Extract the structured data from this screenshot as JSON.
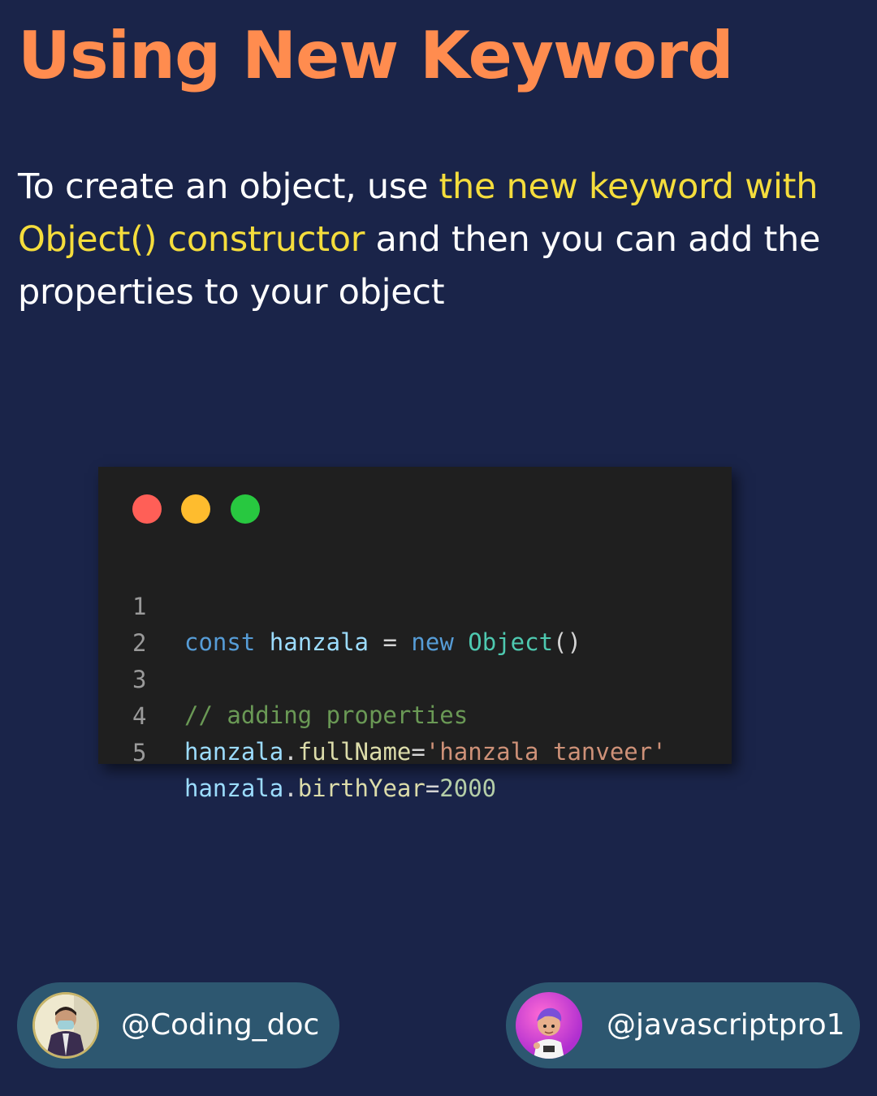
{
  "title": "Using New Keyword",
  "description": {
    "part1": "To create an object, use ",
    "highlight": "the new keyword with Object() constructor",
    "part2": " and then you can add the properties to your object"
  },
  "code": {
    "line_numbers": [
      "1",
      "2",
      "3",
      "4",
      "5"
    ],
    "line1": {
      "kw1": "const",
      "var": "hanzala",
      "op": "=",
      "kw2": "new",
      "cls": "Object",
      "paren": "()"
    },
    "line3": {
      "comment": "// adding properties"
    },
    "line4": {
      "obj": "hanzala",
      "dot": ".",
      "prop": "fullName",
      "eq": "=",
      "str": "'hanzala tanveer'"
    },
    "line5": {
      "obj": "hanzala",
      "dot": ".",
      "prop": "birthYear",
      "eq": "=",
      "num": "2000"
    }
  },
  "profiles": {
    "left": {
      "handle": "@Coding_doc"
    },
    "right": {
      "handle": "@javascriptpro1"
    }
  },
  "colors": {
    "background": "#1a2449",
    "title": "#ff8c4f",
    "highlight": "#f5dd3c",
    "pill": "#2d5770",
    "code_bg": "#1f1f1f"
  }
}
